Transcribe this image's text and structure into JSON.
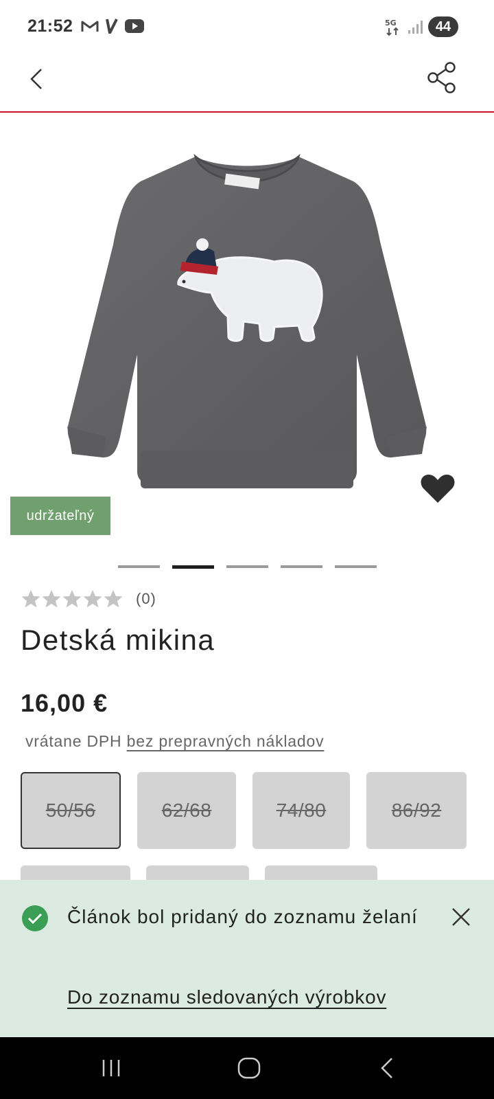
{
  "status_bar": {
    "time": "21:52",
    "network": "5G",
    "battery": "44",
    "icons": [
      "gmail-icon",
      "v-app-icon",
      "youtube-icon",
      "signal-icon"
    ]
  },
  "header": {
    "back_icon": "chevron-left-icon",
    "share_icon": "share-icon"
  },
  "gallery": {
    "badge": "udržateľný",
    "image_count": 5,
    "active_index": 1,
    "wishlist_active": true
  },
  "product": {
    "rating_value": 0,
    "rating_max": 5,
    "rating_count": "(0)",
    "title": "Detská mikina",
    "price": "16,00 €",
    "tax_text": "vrátane DPH",
    "shipping_link": "bez prepravných nákladov"
  },
  "sizes": [
    {
      "label": "50/56",
      "selected": true,
      "available": false
    },
    {
      "label": "62/68",
      "selected": false,
      "available": false
    },
    {
      "label": "74/80",
      "selected": false,
      "available": false
    },
    {
      "label": "86/92",
      "selected": false,
      "available": false
    }
  ],
  "toast": {
    "message": "Článok bol pridaný do zoznamu želaní",
    "link": "Do zoznamu sledovaných výrobkov"
  },
  "colors": {
    "accent_red": "#c8102e",
    "badge_green": "#6fa06d",
    "toast_bg": "#dcebe1",
    "check_green": "#3a9e55"
  }
}
